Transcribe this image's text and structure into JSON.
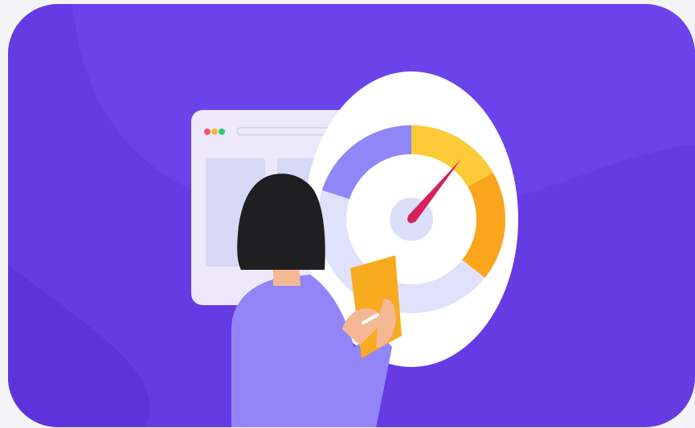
{
  "illustration": {
    "colors": {
      "page_background": "#f4f4f6",
      "card_background": "#653be3",
      "card_background_shape": "#6b43ea",
      "card_background_shape_secondary": "#5f33dc",
      "browser_window": "#ede9fb",
      "browser_panel": "#d7d9f6",
      "browser_dot_red": "#ec5a6a",
      "browser_dot_yellow": "#f6b92a",
      "browser_dot_green": "#36c97c",
      "gauge_ring": "#ffffff",
      "gauge_lavender": "#8f87f7",
      "gauge_pale": "#e0e1fb",
      "gauge_yellow": "#fdcb38",
      "gauge_orange": "#f9a61d",
      "gauge_hub": "#dddff9",
      "needle": "#d7215f",
      "hair": "#1f1f21",
      "sweater": "#9385f9",
      "skin": "#f5b894",
      "clipboard": "#f8ab1e",
      "pen": "#ffffff"
    },
    "gauge": {
      "needle_value_fraction": 0.72
    },
    "icons": {
      "browser_dots": "window-controls-icon",
      "speedometer": "speedometer-icon",
      "person": "person-icon"
    }
  }
}
